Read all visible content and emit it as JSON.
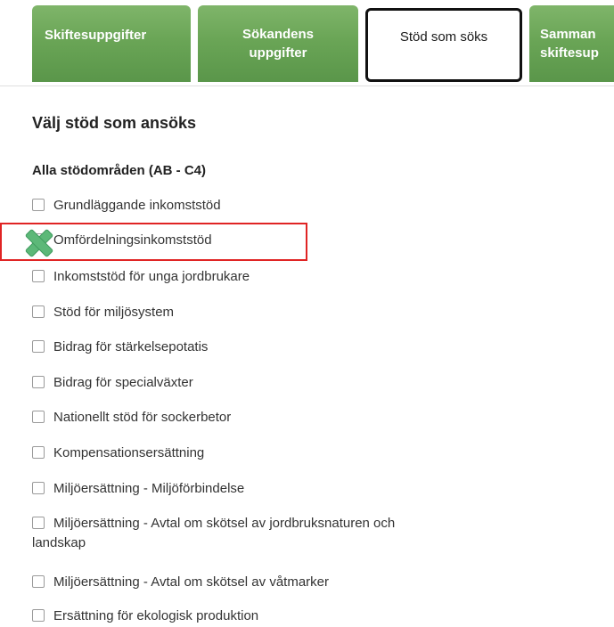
{
  "tabs": [
    {
      "label_line1": "Skiftesuppgifter",
      "label_line2": "",
      "active": false
    },
    {
      "label_line1": "Sökandens",
      "label_line2": "uppgifter",
      "active": false
    },
    {
      "label_line1": "Stöd som söks",
      "label_line2": "",
      "active": true
    },
    {
      "label_line1": "Samman",
      "label_line2": "skiftesup",
      "active": false
    }
  ],
  "section_title": "Välj stöd som ansöks",
  "group_title": "Alla stödområden (AB - C4)",
  "options": [
    {
      "label": "Grundläggande inkomststöd",
      "checked": false
    },
    {
      "label": "Omfördelningsinkomststöd",
      "checked": false
    },
    {
      "label": "Inkomststöd för unga jordbrukare",
      "checked": false
    },
    {
      "label": "Stöd för miljösystem",
      "checked": false
    },
    {
      "label": "Bidrag för stärkelsepotatis",
      "checked": false
    },
    {
      "label": "Bidrag för specialväxter",
      "checked": false
    },
    {
      "label": "Nationellt stöd för sockerbetor",
      "checked": false
    },
    {
      "label": "Kompensationsersättning",
      "checked": false
    },
    {
      "label": "Miljöersättning - Miljöförbindelse",
      "checked": false
    },
    {
      "label": "Miljöersättning - Avtal om skötsel av jordbruksnaturen och",
      "label_line2": "landskap",
      "checked": false
    },
    {
      "label": "Miljöersättning - Avtal om skötsel av våtmarker",
      "checked": false
    },
    {
      "label": "Ersättning för ekologisk produktion",
      "checked": false
    }
  ],
  "colors": {
    "tab_green": "#6aa556",
    "highlight_red": "#e02424",
    "x_mark_green": "#5cb878"
  },
  "icons": {
    "annotation": "x-mark-icon"
  }
}
